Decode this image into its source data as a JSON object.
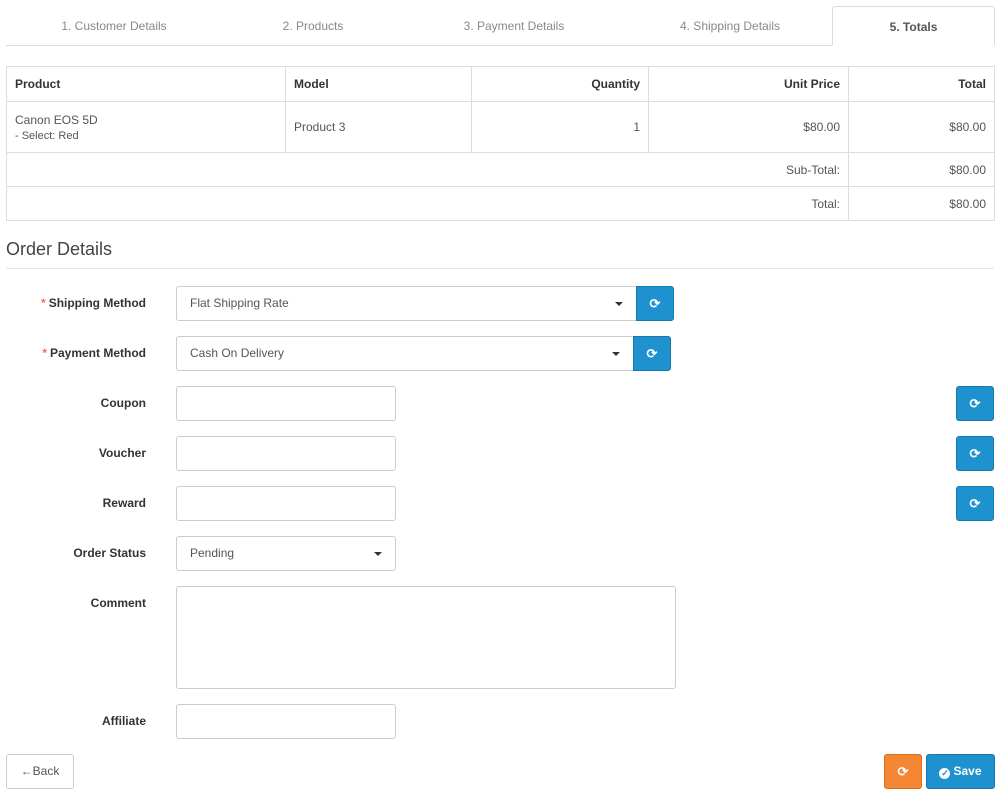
{
  "tabs": [
    {
      "label": "1. Customer Details"
    },
    {
      "label": "2. Products"
    },
    {
      "label": "3. Payment Details"
    },
    {
      "label": "4. Shipping Details"
    },
    {
      "label": "5. Totals"
    }
  ],
  "products_table": {
    "headers": {
      "product": "Product",
      "model": "Model",
      "quantity": "Quantity",
      "unit_price": "Unit Price",
      "total": "Total"
    },
    "rows": [
      {
        "product": "Canon EOS 5D",
        "option": "- Select: Red",
        "model": "Product 3",
        "quantity": "1",
        "unit_price": "$80.00",
        "total": "$80.00"
      }
    ],
    "totals": [
      {
        "label": "Sub-Total:",
        "value": "$80.00"
      },
      {
        "label": "Total:",
        "value": "$80.00"
      }
    ]
  },
  "order_details": {
    "title": "Order Details",
    "required_mark": "*",
    "shipping_method": {
      "label": "Shipping Method",
      "value": "Flat Shipping Rate"
    },
    "payment_method": {
      "label": "Payment Method",
      "value": "Cash On Delivery"
    },
    "coupon": {
      "label": "Coupon",
      "value": ""
    },
    "voucher": {
      "label": "Voucher",
      "value": ""
    },
    "reward": {
      "label": "Reward",
      "value": ""
    },
    "order_status": {
      "label": "Order Status",
      "value": "Pending"
    },
    "comment": {
      "label": "Comment",
      "value": ""
    },
    "affiliate": {
      "label": "Affiliate",
      "value": ""
    }
  },
  "buttons": {
    "back": "Back",
    "save": "Save"
  },
  "icons": {
    "refresh": "refresh-icon",
    "back": "arrow-left-icon",
    "save": "check-circle-icon",
    "caret": "caret-down-icon"
  },
  "colors": {
    "primary": "#1e91cf",
    "warning": "#f38733",
    "required": "#f56b6b"
  }
}
